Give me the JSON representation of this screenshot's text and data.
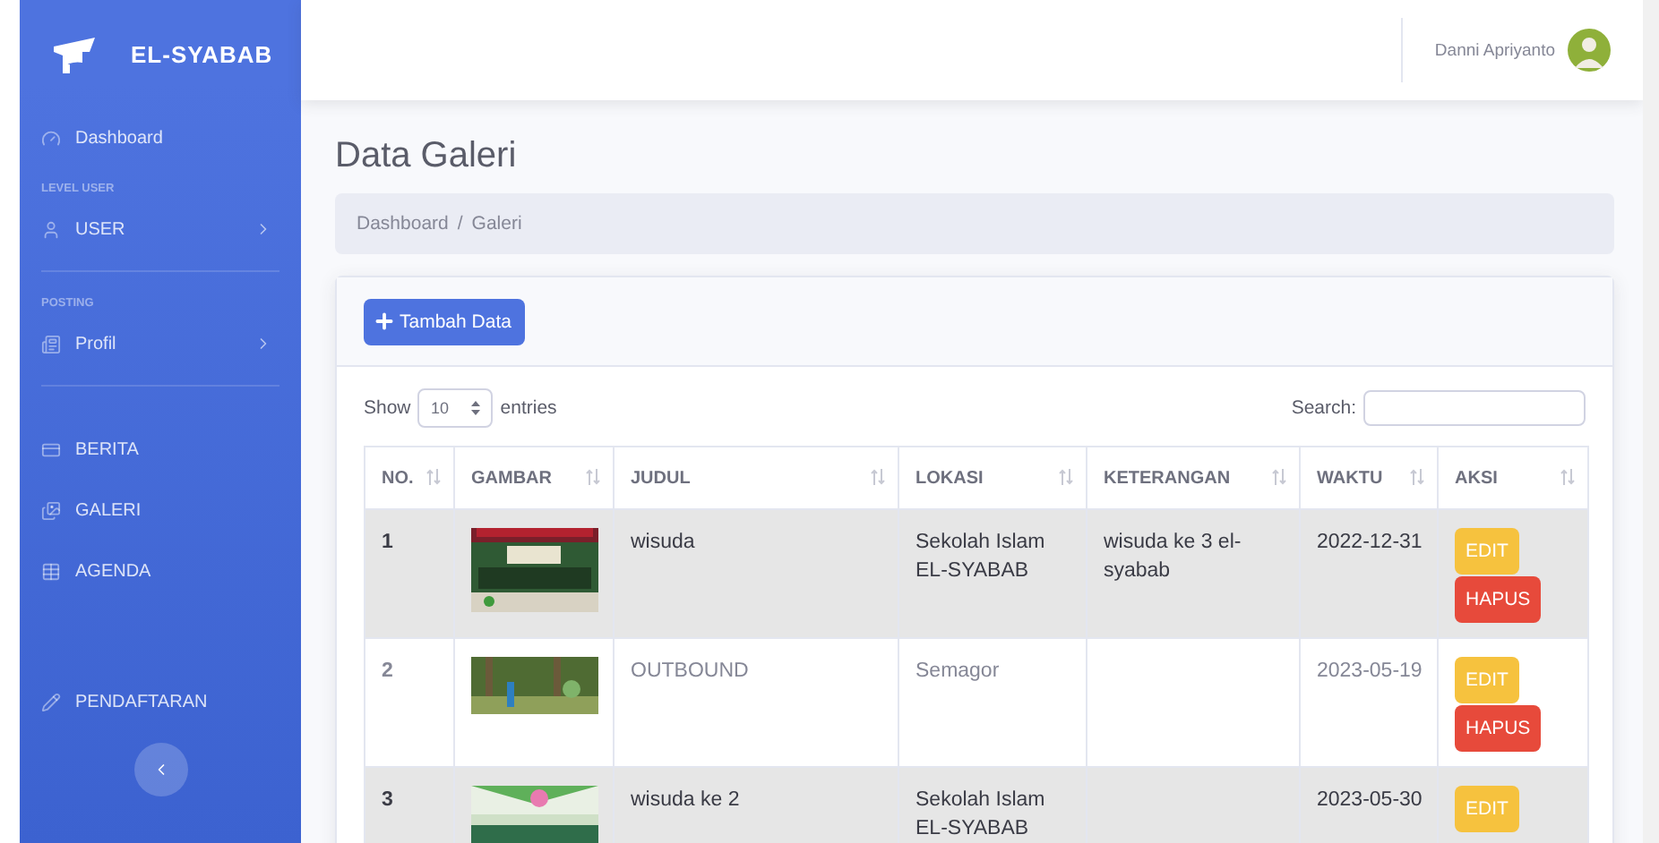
{
  "brand": "EL-SYABAB",
  "sidebar": {
    "items": [
      {
        "kind": "link",
        "label": "Dashboard",
        "expandable": false
      },
      {
        "kind": "heading",
        "label": "LEVEL USER"
      },
      {
        "kind": "link",
        "label": "USER",
        "expandable": true
      },
      {
        "kind": "heading",
        "label": "POSTING"
      },
      {
        "kind": "link",
        "label": "Profil",
        "expandable": true
      },
      {
        "kind": "link",
        "label": "BERITA",
        "expandable": false
      },
      {
        "kind": "link",
        "label": "GALERI",
        "expandable": false
      },
      {
        "kind": "link",
        "label": "AGENDA",
        "expandable": false
      },
      {
        "kind": "link",
        "label": "PENDAFTARAN",
        "expandable": false
      }
    ]
  },
  "user": {
    "name": "Danni Apriyanto"
  },
  "page_title": "Data Galeri",
  "breadcrumb": {
    "items": [
      "Dashboard",
      "Galeri"
    ],
    "separator": "/"
  },
  "add_button": "Tambah Data",
  "length": {
    "show": "Show",
    "value": "10",
    "suffix": "entries"
  },
  "search": {
    "label": "Search:"
  },
  "table": {
    "columns": [
      "NO.",
      "GAMBAR",
      "JUDUL",
      "LOKASI",
      "KETERANGAN",
      "WAKTU",
      "AKSI"
    ],
    "rows": [
      {
        "no": "1",
        "judul": "wisuda",
        "lokasi": "Sekolah Islam EL-SYABAB",
        "keterangan": "wisuda ke 3 el-syabab",
        "waktu": "2022-12-31",
        "actions": [
          "EDIT",
          "HAPUS"
        ]
      },
      {
        "no": "2",
        "judul": "OUTBOUND",
        "lokasi": "Semagor",
        "keterangan": "",
        "waktu": "2023-05-19",
        "actions": [
          "EDIT",
          "HAPUS"
        ]
      },
      {
        "no": "3",
        "judul": "wisuda ke 2",
        "lokasi": "Sekolah Islam EL-SYABAB",
        "keterangan": "",
        "waktu": "2023-05-30",
        "actions": [
          "EDIT"
        ]
      }
    ]
  }
}
